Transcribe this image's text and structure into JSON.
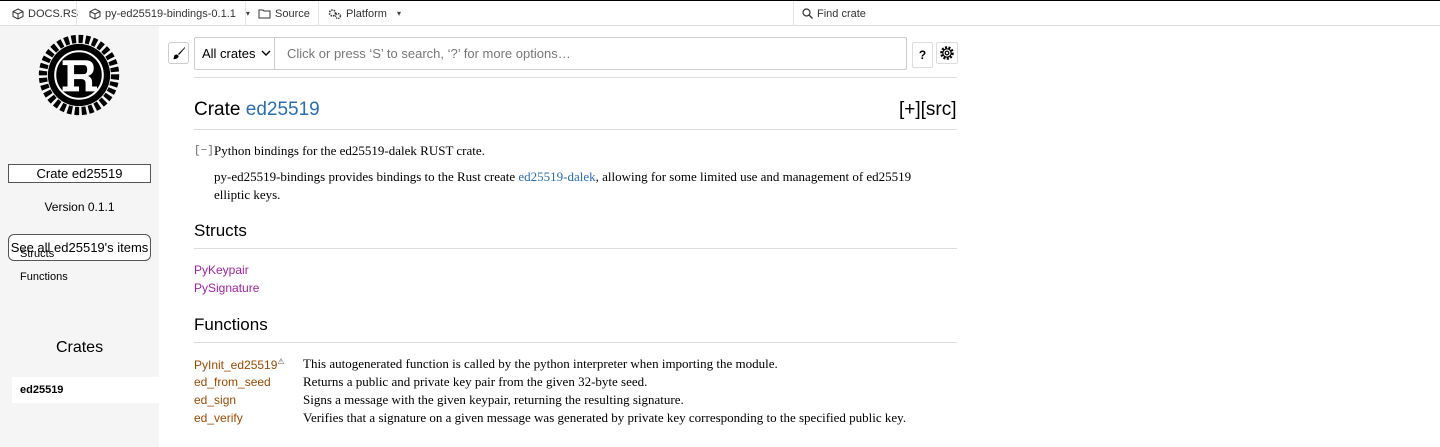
{
  "topnav": {
    "docsrs": "DOCS.RS",
    "package": "py-ed25519-bindings-0.1.1",
    "source": "Source",
    "platform": "Platform",
    "find_crate": "Find crate",
    "caret": "▾"
  },
  "sidebar": {
    "crate_label": "Crate ed25519",
    "version": "Version 0.1.1",
    "see_all": "See all ed25519's items",
    "links": [
      "Structs",
      "Functions"
    ],
    "crates_title": "Crates",
    "crate_item": "ed25519"
  },
  "search": {
    "crate_select": "All crates",
    "placeholder": "Click or press ‘S’ to search, ‘?’ for more options…",
    "help": "?"
  },
  "main": {
    "crate_word": "Crate",
    "crate_name": "ed25519",
    "src_links": "[+][src]",
    "toggle": "[−]",
    "summary": "Python bindings for the ed25519-dalek RUST crate.",
    "para_before": "py-ed25519-bindings provides bindings to the Rust create ",
    "para_link": "ed25519-dalek",
    "para_after": ", allowing for some limited use and management of ed25519 elliptic keys.",
    "structs_title": "Structs",
    "structs": [
      "PyKeypair",
      "PySignature"
    ],
    "functions_title": "Functions",
    "functions": [
      {
        "name": "PyInit_ed25519",
        "warn": "⚠",
        "desc": "This autogenerated function is called by the python interpreter when importing the module."
      },
      {
        "name": "ed_from_seed",
        "warn": "",
        "desc": "Returns a public and private key pair from the given 32-byte seed."
      },
      {
        "name": "ed_sign",
        "warn": "",
        "desc": "Signs a message with the given keypair, returning the resulting signature."
      },
      {
        "name": "ed_verify",
        "warn": "",
        "desc": "Verifies that a signature on a given message was generated by private key corresponding to the specified public key."
      }
    ]
  },
  "colors": {
    "link_blue": "#2a6db2",
    "struct_purple": "#a023a0",
    "fn_brown": "#9b4a00",
    "sidebar_bg": "#f5f5f5"
  }
}
